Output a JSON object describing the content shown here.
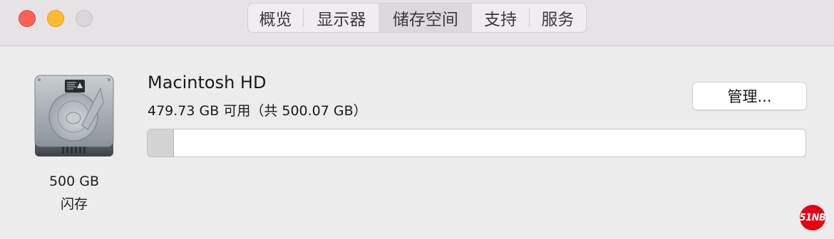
{
  "window": {
    "traffic_lights": [
      "close",
      "minimize",
      "zoom"
    ],
    "colors": {
      "close": "#fe5f57",
      "minimize": "#febc2e",
      "zoom_disabled": "#d9d6d9"
    }
  },
  "tabs": [
    {
      "label": "概览",
      "selected": false
    },
    {
      "label": "显示器",
      "selected": false
    },
    {
      "label": "储存空间",
      "selected": true
    },
    {
      "label": "支持",
      "selected": false
    },
    {
      "label": "服务",
      "selected": false
    }
  ],
  "disk": {
    "icon": "hard-drive-icon",
    "size": "500 GB",
    "type": "闪存"
  },
  "volume": {
    "name": "Macintosh HD",
    "capacity_text": "479.73 GB 可用（共 500.07 GB）",
    "used_fraction": 0.04,
    "manage_label": "管理..."
  },
  "watermark": {
    "text": "51NB",
    "color": "#e60012"
  }
}
